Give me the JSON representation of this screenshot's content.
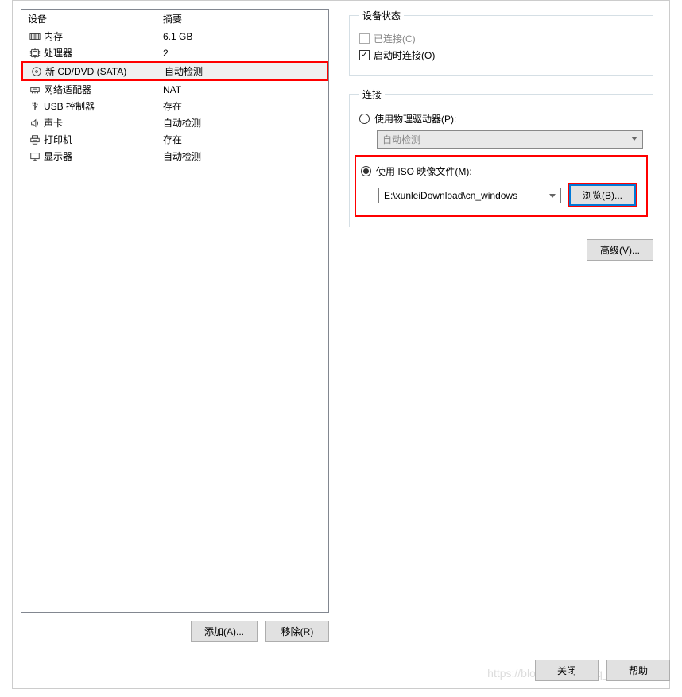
{
  "list": {
    "header_device": "设备",
    "header_summary": "摘要",
    "rows": [
      {
        "name": "内存",
        "summary": "6.1 GB"
      },
      {
        "name": "处理器",
        "summary": "2"
      },
      {
        "name": "新 CD/DVD (SATA)",
        "summary": "自动检测"
      },
      {
        "name": "网络适配器",
        "summary": "NAT"
      },
      {
        "name": "USB 控制器",
        "summary": "存在"
      },
      {
        "name": "声卡",
        "summary": "自动检测"
      },
      {
        "name": "打印机",
        "summary": "存在"
      },
      {
        "name": "显示器",
        "summary": "自动检测"
      }
    ]
  },
  "buttons": {
    "add": "添加(A)...",
    "remove": "移除(R)",
    "browse": "浏览(B)...",
    "advanced": "高级(V)...",
    "close": "关闭",
    "help": "帮助"
  },
  "status_group": {
    "legend": "设备状态",
    "connected": "已连接(C)",
    "connect_at_poweron": "启动时连接(O)"
  },
  "connection_group": {
    "legend": "连接",
    "physical": "使用物理驱动器(P):",
    "physical_combo": "自动检测",
    "iso": "使用 ISO 映像文件(M):",
    "iso_file": "E:\\xunleiDownload\\cn_windows"
  },
  "watermark": "https://blog.csdn.net/qq_43655308"
}
